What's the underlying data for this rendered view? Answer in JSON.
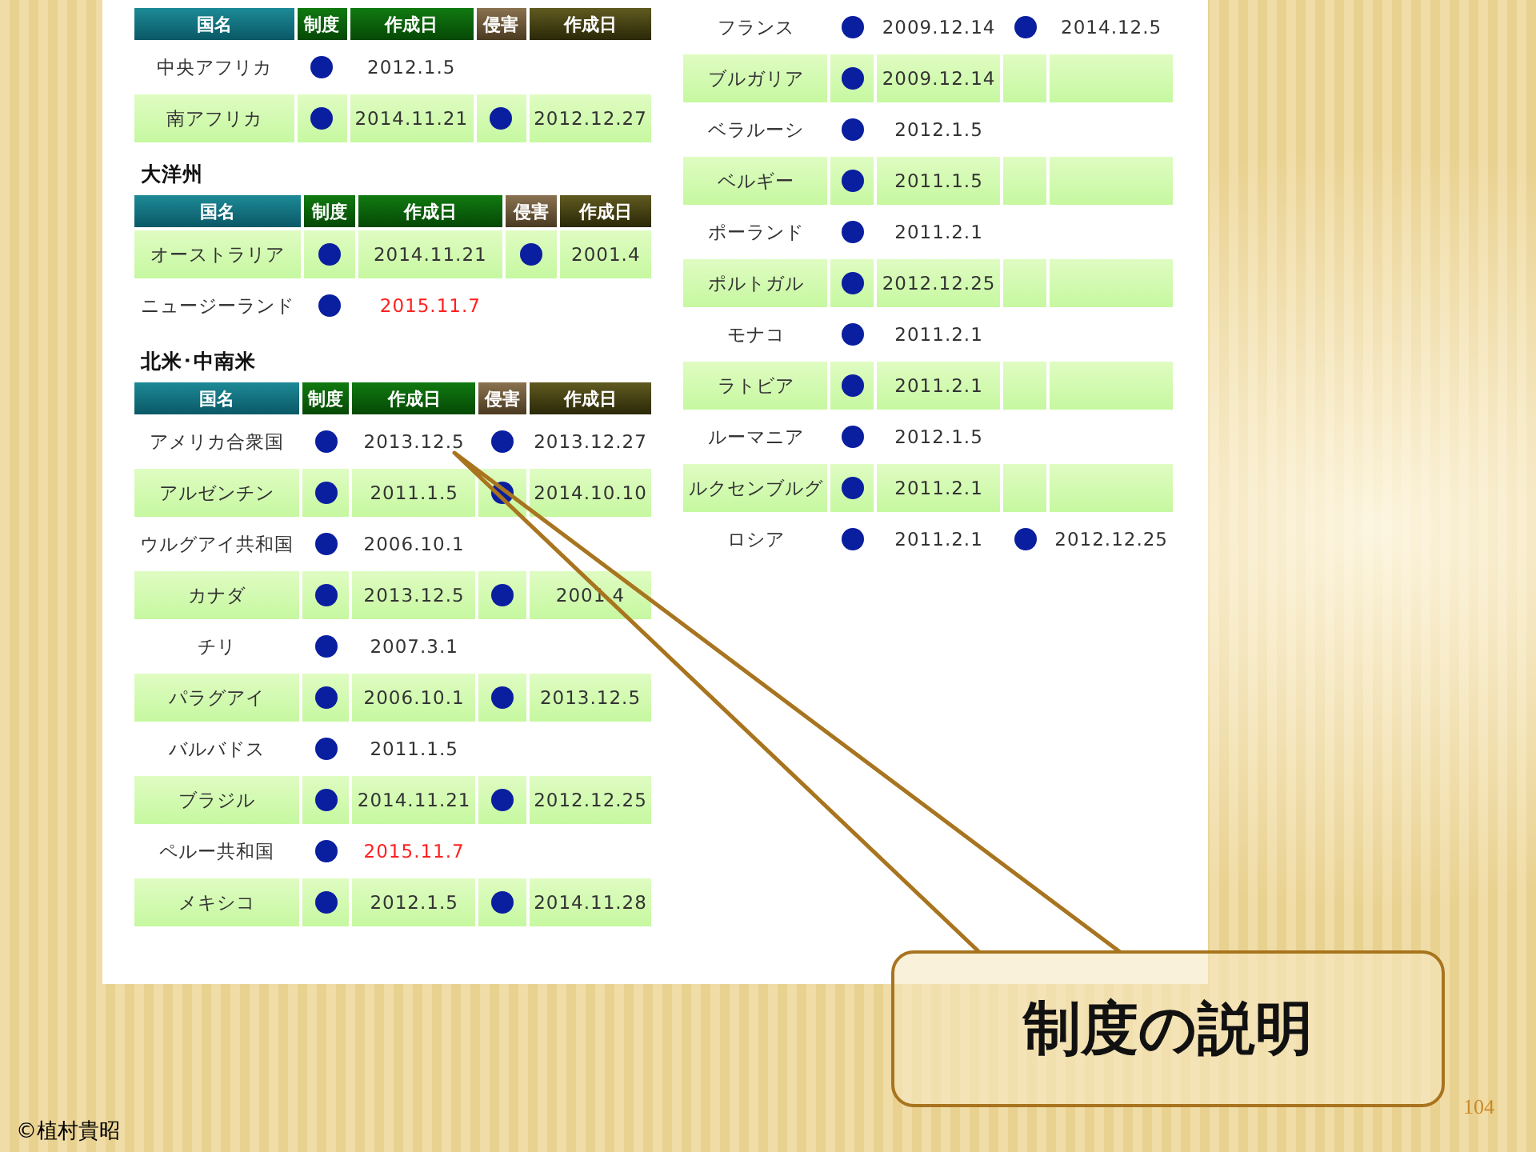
{
  "left_tables": [
    {
      "columns": [
        "国名",
        "制度",
        "作成日",
        "侵害",
        "作成日"
      ],
      "rows": [
        {
          "country": "中央アフリカ",
          "system": true,
          "system_date": "2012.1.5",
          "system_date_highlighted": false,
          "infringement": false,
          "infringement_date": null,
          "shaded": false
        },
        {
          "country": "南アフリカ",
          "system": true,
          "system_date": "2014.11.21",
          "system_date_highlighted": false,
          "infringement": true,
          "infringement_date": "2012.12.27",
          "shaded": true
        }
      ]
    },
    {
      "title": "大洋州",
      "columns": [
        "国名",
        "制度",
        "作成日",
        "侵害",
        "作成日"
      ],
      "rows": [
        {
          "country": "オーストラリア",
          "system": true,
          "system_date": "2014.11.21",
          "system_date_highlighted": false,
          "infringement": true,
          "infringement_date": "2001.4",
          "shaded": true
        },
        {
          "country": "ニュージーランド",
          "system": true,
          "system_date": "2015.11.7",
          "system_date_highlighted": true,
          "infringement": false,
          "infringement_date": null,
          "shaded": false
        }
      ]
    },
    {
      "title": "北米･中南米",
      "columns": [
        "国名",
        "制度",
        "作成日",
        "侵害",
        "作成日"
      ],
      "rows": [
        {
          "country": "アメリカ合衆国",
          "system": true,
          "system_date": "2013.12.5",
          "system_date_highlighted": false,
          "infringement": true,
          "infringement_date": "2013.12.27",
          "shaded": false
        },
        {
          "country": "アルゼンチン",
          "system": true,
          "system_date": "2011.1.5",
          "system_date_highlighted": false,
          "infringement": true,
          "infringement_date": "2014.10.10",
          "shaded": true
        },
        {
          "country": "ウルグアイ共和国",
          "system": true,
          "system_date": "2006.10.1",
          "system_date_highlighted": false,
          "infringement": false,
          "infringement_date": null,
          "shaded": false
        },
        {
          "country": "カナダ",
          "system": true,
          "system_date": "2013.12.5",
          "system_date_highlighted": false,
          "infringement": true,
          "infringement_date": "2001.4",
          "shaded": true
        },
        {
          "country": "チリ",
          "system": true,
          "system_date": "2007.3.1",
          "system_date_highlighted": false,
          "infringement": false,
          "infringement_date": null,
          "shaded": false
        },
        {
          "country": "パラグアイ",
          "system": true,
          "system_date": "2006.10.1",
          "system_date_highlighted": false,
          "infringement": true,
          "infringement_date": "2013.12.5",
          "shaded": true
        },
        {
          "country": "バルバドス",
          "system": true,
          "system_date": "2011.1.5",
          "system_date_highlighted": false,
          "infringement": false,
          "infringement_date": null,
          "shaded": false
        },
        {
          "country": "ブラジル",
          "system": true,
          "system_date": "2014.11.21",
          "system_date_highlighted": false,
          "infringement": true,
          "infringement_date": "2012.12.25",
          "shaded": true
        },
        {
          "country": "ペルー共和国",
          "system": true,
          "system_date": "2015.11.7",
          "system_date_highlighted": true,
          "infringement": false,
          "infringement_date": null,
          "shaded": false
        },
        {
          "country": "メキシコ",
          "system": true,
          "system_date": "2012.1.5",
          "system_date_highlighted": false,
          "infringement": true,
          "infringement_date": "2014.11.28",
          "shaded": true
        }
      ]
    }
  ],
  "right_table": {
    "rows": [
      {
        "country": "フランス",
        "system": true,
        "system_date": "2009.12.14",
        "system_date_highlighted": false,
        "infringement": true,
        "infringement_date": "2014.12.5",
        "shaded": false
      },
      {
        "country": "ブルガリア",
        "system": true,
        "system_date": "2009.12.14",
        "system_date_highlighted": false,
        "infringement": false,
        "infringement_date": null,
        "shaded": true
      },
      {
        "country": "ベラルーシ",
        "system": true,
        "system_date": "2012.1.5",
        "system_date_highlighted": false,
        "infringement": false,
        "infringement_date": null,
        "shaded": false
      },
      {
        "country": "ベルギー",
        "system": true,
        "system_date": "2011.1.5",
        "system_date_highlighted": false,
        "infringement": false,
        "infringement_date": null,
        "shaded": true
      },
      {
        "country": "ポーランド",
        "system": true,
        "system_date": "2011.2.1",
        "system_date_highlighted": false,
        "infringement": false,
        "infringement_date": null,
        "shaded": false
      },
      {
        "country": "ポルトガル",
        "system": true,
        "system_date": "2012.12.25",
        "system_date_highlighted": false,
        "infringement": false,
        "infringement_date": null,
        "shaded": true
      },
      {
        "country": "モナコ",
        "system": true,
        "system_date": "2011.2.1",
        "system_date_highlighted": false,
        "infringement": false,
        "infringement_date": null,
        "shaded": false
      },
      {
        "country": "ラトビア",
        "system": true,
        "system_date": "2011.2.1",
        "system_date_highlighted": false,
        "infringement": false,
        "infringement_date": null,
        "shaded": true
      },
      {
        "country": "ルーマニア",
        "system": true,
        "system_date": "2012.1.5",
        "system_date_highlighted": false,
        "infringement": false,
        "infringement_date": null,
        "shaded": false
      },
      {
        "country": "ルクセンブルグ",
        "system": true,
        "system_date": "2011.2.1",
        "system_date_highlighted": false,
        "infringement": false,
        "infringement_date": null,
        "shaded": true
      },
      {
        "country": "ロシア",
        "system": true,
        "system_date": "2011.2.1",
        "system_date_highlighted": false,
        "infringement": true,
        "infringement_date": "2012.12.25",
        "shaded": false
      }
    ]
  },
  "callout": {
    "text": "制度の説明"
  },
  "footer": {
    "copyright": "©植村貴昭",
    "page_number": "104"
  }
}
